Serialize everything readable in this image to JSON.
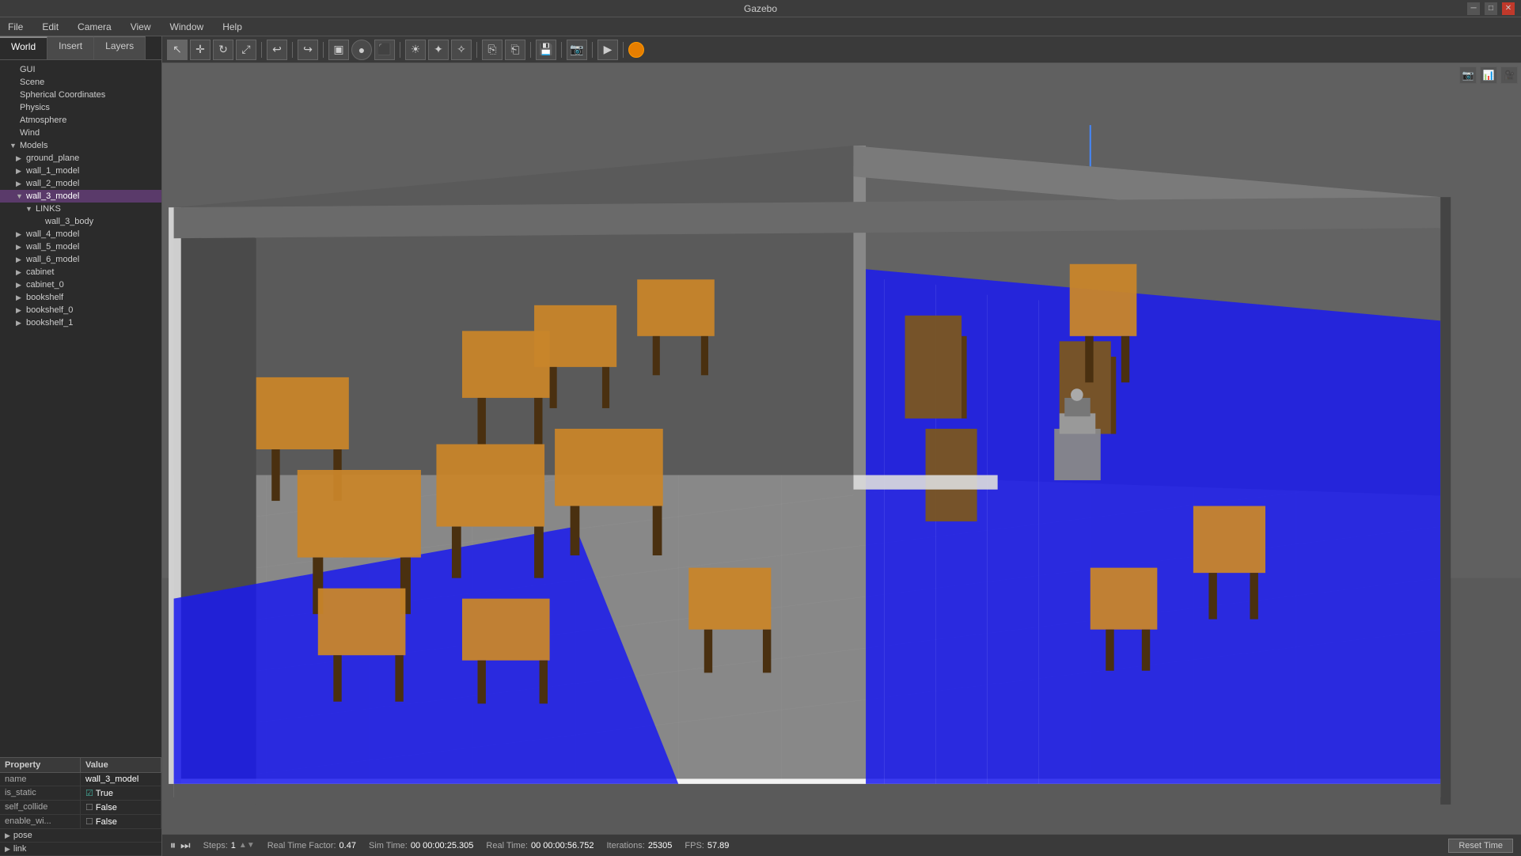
{
  "window": {
    "title": "Gazebo",
    "controls": [
      "minimize",
      "restore",
      "close"
    ]
  },
  "menubar": {
    "items": [
      "File",
      "Edit",
      "Camera",
      "View",
      "Window",
      "Help"
    ]
  },
  "tabs": {
    "items": [
      "World",
      "Insert",
      "Layers"
    ],
    "active": "World"
  },
  "toolbar": {
    "buttons": [
      {
        "name": "select",
        "icon": "↖",
        "title": "Select Mode"
      },
      {
        "name": "translate",
        "icon": "✛",
        "title": "Translate Mode"
      },
      {
        "name": "rotate",
        "icon": "↻",
        "title": "Rotate Mode"
      },
      {
        "name": "scale",
        "icon": "⤢",
        "title": "Scale Mode"
      },
      {
        "name": "undo",
        "icon": "↩",
        "title": "Undo"
      },
      {
        "name": "sep1",
        "icon": "",
        "title": ""
      },
      {
        "name": "redo",
        "icon": "↪",
        "title": "Redo"
      },
      {
        "name": "sep2",
        "icon": "",
        "title": ""
      },
      {
        "name": "box",
        "icon": "▣",
        "title": "Box"
      },
      {
        "name": "sphere",
        "icon": "●",
        "title": "Sphere"
      },
      {
        "name": "cylinder",
        "icon": "⬛",
        "title": "Cylinder"
      },
      {
        "name": "light-point",
        "icon": "☀",
        "title": "Point Light"
      },
      {
        "name": "light-spot",
        "icon": "✦",
        "title": "Spot Light"
      },
      {
        "name": "light-dir",
        "icon": "✧",
        "title": "Directional Light"
      },
      {
        "name": "copy",
        "icon": "⎘",
        "title": "Copy"
      },
      {
        "name": "sep3",
        "icon": "",
        "title": ""
      },
      {
        "name": "paste",
        "icon": "⎗",
        "title": "Paste"
      },
      {
        "name": "sep4",
        "icon": "",
        "title": ""
      },
      {
        "name": "save-world",
        "icon": "💾",
        "title": "Save World"
      },
      {
        "name": "sep5",
        "icon": "",
        "title": ""
      },
      {
        "name": "screenshot",
        "icon": "📷",
        "title": "Screenshot"
      },
      {
        "name": "sep6",
        "icon": "",
        "title": ""
      },
      {
        "name": "record",
        "icon": "▶",
        "title": "Record"
      },
      {
        "name": "color",
        "icon": "🟠",
        "title": "Color"
      }
    ]
  },
  "world_tree": {
    "items": [
      {
        "id": "gui",
        "label": "GUI",
        "indent": 0,
        "arrow": "",
        "selected": false
      },
      {
        "id": "scene",
        "label": "Scene",
        "indent": 0,
        "arrow": "",
        "selected": false
      },
      {
        "id": "spherical-coords",
        "label": "Spherical Coordinates",
        "indent": 0,
        "arrow": "",
        "selected": false
      },
      {
        "id": "physics",
        "label": "Physics",
        "indent": 0,
        "arrow": "",
        "selected": false
      },
      {
        "id": "atmosphere",
        "label": "Atmosphere",
        "indent": 0,
        "arrow": "",
        "selected": false
      },
      {
        "id": "wind",
        "label": "Wind",
        "indent": 0,
        "arrow": "",
        "selected": false
      },
      {
        "id": "models",
        "label": "Models",
        "indent": 0,
        "arrow": "▼",
        "selected": false
      },
      {
        "id": "ground-plane",
        "label": "ground_plane",
        "indent": 1,
        "arrow": "▶",
        "selected": false
      },
      {
        "id": "wall-1-model",
        "label": "wall_1_model",
        "indent": 1,
        "arrow": "▶",
        "selected": false
      },
      {
        "id": "wall-2-model",
        "label": "wall_2_model",
        "indent": 1,
        "arrow": "▶",
        "selected": false
      },
      {
        "id": "wall-3-model",
        "label": "wall_3_model",
        "indent": 1,
        "arrow": "▼",
        "selected": true,
        "highlighted": true
      },
      {
        "id": "links",
        "label": "LINKS",
        "indent": 2,
        "arrow": "▼",
        "selected": false
      },
      {
        "id": "wall-3-body",
        "label": "wall_3_body",
        "indent": 3,
        "arrow": "",
        "selected": false
      },
      {
        "id": "wall-4-model",
        "label": "wall_4_model",
        "indent": 1,
        "arrow": "▶",
        "selected": false
      },
      {
        "id": "wall-5-model",
        "label": "wall_5_model",
        "indent": 1,
        "arrow": "▶",
        "selected": false
      },
      {
        "id": "wall-6-model",
        "label": "wall_6_model",
        "indent": 1,
        "arrow": "▶",
        "selected": false
      },
      {
        "id": "cabinet",
        "label": "cabinet",
        "indent": 1,
        "arrow": "▶",
        "selected": false
      },
      {
        "id": "cabinet-0",
        "label": "cabinet_0",
        "indent": 1,
        "arrow": "▶",
        "selected": false
      },
      {
        "id": "bookshelf",
        "label": "bookshelf",
        "indent": 1,
        "arrow": "▶",
        "selected": false
      },
      {
        "id": "bookshelf-0",
        "label": "bookshelf_0",
        "indent": 1,
        "arrow": "▶",
        "selected": false
      },
      {
        "id": "bookshelf-1",
        "label": "bookshelf_1",
        "indent": 1,
        "arrow": "▶",
        "selected": false
      }
    ]
  },
  "properties": {
    "header": {
      "col1": "Property",
      "col2": "Value"
    },
    "rows": [
      {
        "key": "name",
        "value": "wall_3_model",
        "type": "text"
      },
      {
        "key": "is_static",
        "value": "True",
        "type": "checkbox_true"
      },
      {
        "key": "self_collide",
        "value": "False",
        "type": "checkbox_false"
      },
      {
        "key": "enable_wi...",
        "value": "False",
        "type": "checkbox_false"
      }
    ],
    "expandable": [
      {
        "key": "pose"
      },
      {
        "key": "link"
      }
    ]
  },
  "statusbar": {
    "play_pause": "⏸",
    "step_forward": "⏭",
    "steps_label": "Steps:",
    "steps_value": "1",
    "realtime_factor_label": "Real Time Factor:",
    "realtime_factor_value": "0.47",
    "simtime_label": "Sim Time:",
    "simtime_value": "00 00:00:25.305",
    "realtime_label": "Real Time:",
    "realtime_value": "00 00:00:56.752",
    "iterations_label": "Iterations:",
    "iterations_value": "25305",
    "fps_label": "FPS:",
    "fps_value": "57.89",
    "reset_button": "Reset Time"
  },
  "viewport": {
    "top_icons": [
      "📷",
      "📊",
      "🎥"
    ]
  }
}
